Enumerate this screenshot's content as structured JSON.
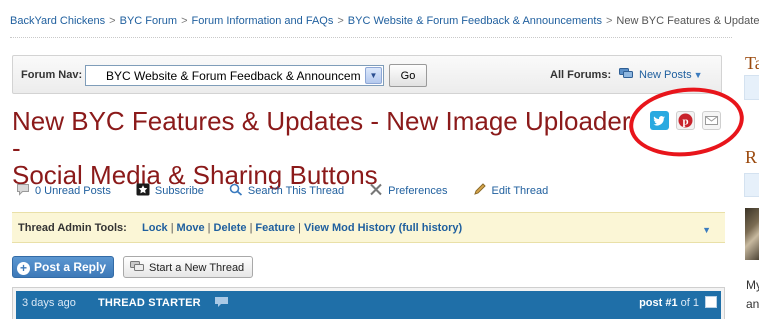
{
  "breadcrumb": {
    "items": [
      "BackYard Chickens",
      "BYC Forum",
      "Forum Information and FAQs",
      "BYC Website & Forum Feedback & Announcements"
    ],
    "separator": ">",
    "current": "New BYC Features & Updates - N"
  },
  "forum_nav": {
    "label": "Forum Nav:",
    "selected": "BYC Website & Forum Feedback & Announcem",
    "go_label": "Go",
    "all_forums_label": "All Forums:",
    "new_posts_label": "New Posts"
  },
  "thread": {
    "title_line1": "New BYC Features & Updates - New Image Uploader -",
    "title_line2": "Social Media & Sharing Buttons"
  },
  "share_icons": [
    "twitter-icon",
    "pinterest-icon",
    "email-icon"
  ],
  "actions": [
    {
      "label": "0 Unread Posts",
      "icon": "comment-icon"
    },
    {
      "label": "Subscribe",
      "icon": "star-icon"
    },
    {
      "label": "Search This Thread",
      "icon": "search-icon"
    },
    {
      "label": "Preferences",
      "icon": "tools-icon"
    },
    {
      "label": "Edit Thread",
      "icon": "pencil-icon"
    }
  ],
  "admin_tools": {
    "label": "Thread Admin Tools:",
    "links": [
      "Lock",
      "Move",
      "Delete",
      "Feature",
      "View Mod History"
    ],
    "full_history": "(full history)"
  },
  "buttons": {
    "post_reply": "Post a Reply",
    "new_thread": "Start a New Thread"
  },
  "post_header": {
    "time": "3 days ago",
    "starter": "THREAD STARTER",
    "post_label": "post #1",
    "of_label": "of 1"
  },
  "sidebar": {
    "heading1": "Ta",
    "heading2": "R",
    "text1": "My",
    "text2": "an"
  },
  "colors": {
    "title": "#8b1a1a",
    "link": "#1f5f9e",
    "post_bar": "#1f6fa8",
    "highlight_circle": "#e8151b",
    "admin_bg": "#fbf6d6"
  }
}
